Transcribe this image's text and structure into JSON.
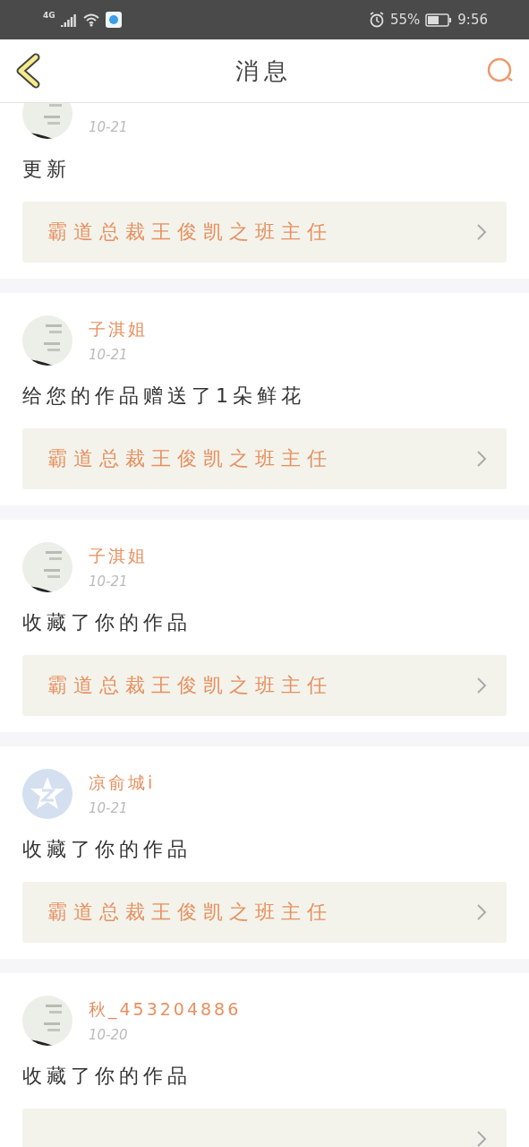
{
  "status_bar": {
    "network": "4G",
    "battery": "55%",
    "time": "9:56"
  },
  "header": {
    "title": "消息"
  },
  "messages": [
    {
      "date": "10-21",
      "text": "更新",
      "work": "霸道总裁王俊凯之班主任"
    },
    {
      "name": "子淇姐",
      "date": "10-21",
      "text": "给您的作品赠送了1朵鲜花",
      "work": "霸道总裁王俊凯之班主任"
    },
    {
      "name": "子淇姐",
      "date": "10-21",
      "text": "收藏了你的作品",
      "work": "霸道总裁王俊凯之班主任"
    },
    {
      "name": "凉俞城i",
      "date": "10-21",
      "text": "收藏了你的作品",
      "work": "霸道总裁王俊凯之班主任",
      "avatar": {
        "kind": "default"
      }
    },
    {
      "name": "秋_453204886",
      "date": "10-20",
      "text": "收藏了你的作品"
    }
  ]
}
